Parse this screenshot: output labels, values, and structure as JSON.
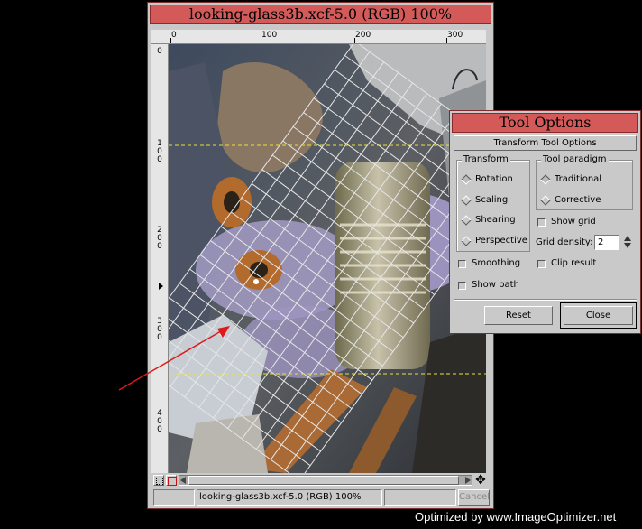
{
  "image_window": {
    "title": "looking-glass3b.xcf-5.0 (RGB) 100%",
    "ruler_h_labels": [
      "0",
      "100",
      "200",
      "300"
    ],
    "ruler_v_labels": [
      "0",
      "1\n0\n0",
      "2\n0\n0",
      "3\n0\n0",
      "4\n0\n0"
    ],
    "status_text": "looking-glass3b.xcf-5.0 (RGB) 100%",
    "cancel_label": "Cancel"
  },
  "tool_options": {
    "title": "Tool Options",
    "header": "Transform Tool Options",
    "transform_group": {
      "label": "Transform",
      "options": [
        "Rotation",
        "Scaling",
        "Shearing",
        "Perspective"
      ],
      "selected": "Rotation"
    },
    "paradigm_group": {
      "label": "Tool paradigm",
      "options": [
        "Traditional",
        "Corrective"
      ],
      "selected": "Traditional"
    },
    "show_grid_label": "Show grid",
    "show_grid_checked": false,
    "grid_density_label": "Grid density:",
    "grid_density_value": "2",
    "smoothing_label": "Smoothing",
    "smoothing_checked": false,
    "clip_result_label": "Clip result",
    "clip_result_checked": false,
    "show_path_label": "Show path",
    "show_path_checked": false,
    "reset_label": "Reset",
    "close_label": "Close"
  },
  "watermark": "Optimized by www.ImageOptimizer.net",
  "colors": {
    "titlebar": "#d45a5a",
    "window_bg": "#c9c9c9",
    "arrow": "#e01818",
    "guide": "#e8e23a"
  }
}
